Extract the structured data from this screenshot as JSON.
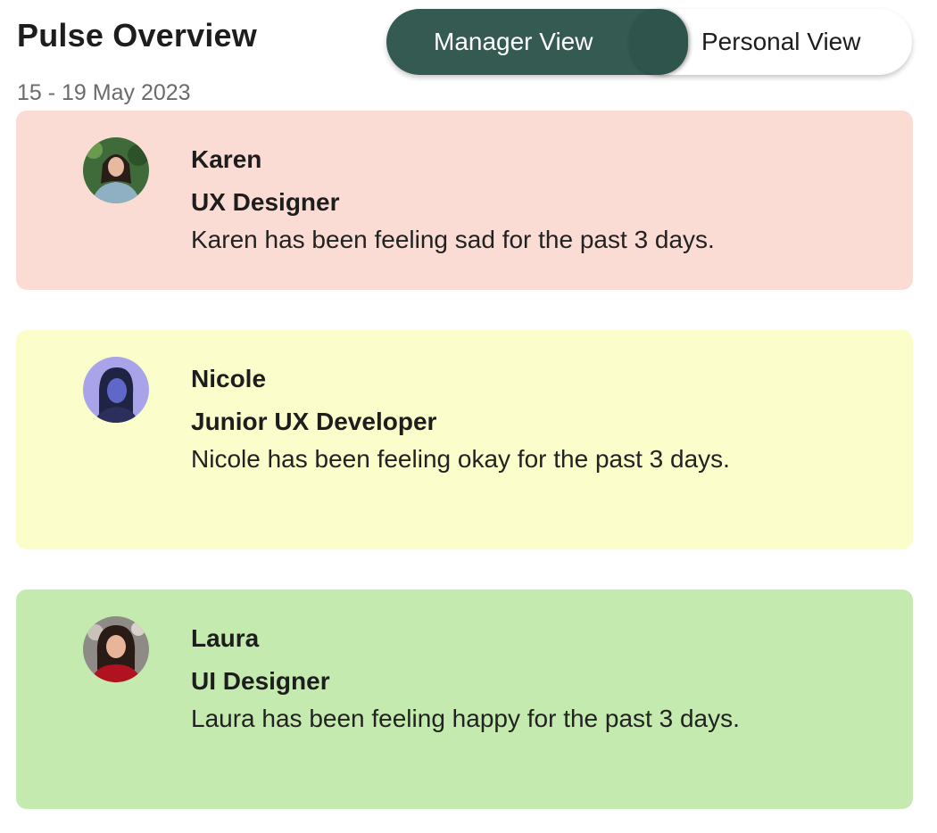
{
  "header": {
    "title": "Pulse Overview",
    "date_range": "15 - 19 May 2023"
  },
  "view_toggle": {
    "active_label": "Manager View",
    "inactive_label": "Personal View",
    "active_color": "#355a52"
  },
  "cards": [
    {
      "name": "Karen",
      "role": "UX Designer",
      "status": "Karen has been feeling sad for the past 3 days.",
      "mood": "sad",
      "background": "#fadcd5"
    },
    {
      "name": "Nicole",
      "role": "Junior UX Developer",
      "status": "Nicole has been feeling okay for the past 3 days.",
      "mood": "okay",
      "background": "#fbfdca"
    },
    {
      "name": "Laura",
      "role": "UI Designer",
      "status": "Laura has been feeling happy for the past 3 days.",
      "mood": "happy",
      "background": "#c4eaaf"
    }
  ]
}
